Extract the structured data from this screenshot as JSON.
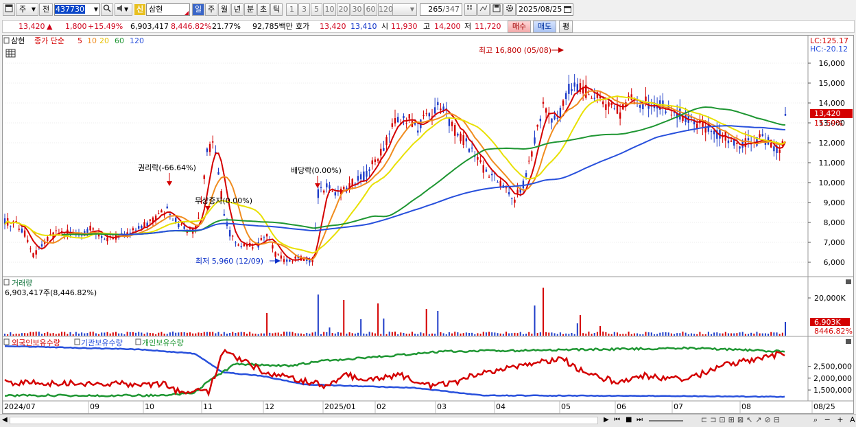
{
  "toolbar": {
    "type_label": "주",
    "scope_label": "전",
    "code": "437730",
    "credit_badge": "신",
    "stock_name": "삼현",
    "periods": [
      "일",
      "주",
      "월",
      "년",
      "분",
      "초",
      "틱"
    ],
    "active_period": "일",
    "intervals": [
      "1",
      "3",
      "5",
      "10",
      "20",
      "30",
      "60",
      "120"
    ],
    "page_current": "265",
    "page_total": "/347",
    "date": "2025/08/25"
  },
  "quote": {
    "price": "13,420",
    "arrow": "▲",
    "change": "1,800",
    "change_pct": "+15.49%",
    "volume": "6,903,417",
    "volume_ratio": "8,446.82%",
    "turnover": "21.77%",
    "amount": "92,785백만",
    "quote_label": "호가",
    "ask": "13,420",
    "bid": "13,410",
    "open_label": "시",
    "open": "11,930",
    "high_label": "고",
    "high": "14,200",
    "low_label": "저",
    "low": "11,720",
    "buy_label": "매수",
    "sell_label": "매도",
    "eval_label": "평"
  },
  "price_panel": {
    "stock_name": "삼현",
    "indicator_label": "종가 단순",
    "ma_periods": [
      "5",
      "10",
      "20",
      "60",
      "120"
    ],
    "ma_colors": [
      "#d40000",
      "#f08c1e",
      "#e8e000",
      "#1e9632",
      "#2850dc"
    ],
    "lc_label": "LC:125.17",
    "hc_label": "HC:-20.12",
    "price_ticks": [
      "6,000",
      "7,000",
      "8,000",
      "9,000",
      "10,000",
      "11,000",
      "12,000",
      "13,000",
      "14,000",
      "15,000",
      "16,000"
    ],
    "current_price_tag": "13,420",
    "current_pct_tag": "15.59%",
    "annotations": {
      "high": "최고 16,800 (05/08)",
      "low": "최저 5,960 (12/09)",
      "rights": "권리락(-66.64%)",
      "bonus": "무상증자(0.00%)",
      "dividend": "배당락(0.00%)"
    }
  },
  "volume_panel": {
    "title": "거래량",
    "summary": "6,903,417주(8,446.82%)",
    "tick": "20,000K",
    "current_tag": "6,903K",
    "pct_tag": "8446.82%"
  },
  "holdings_panel": {
    "legend": [
      "외국인보유수량",
      "기관보유수량",
      "개인보유수량"
    ],
    "colors": [
      "#d40000",
      "#2850dc",
      "#1e9632"
    ],
    "ticks": [
      "1,500,000",
      "2,000,000",
      "2,500,000"
    ]
  },
  "x_axis": {
    "labels": [
      "2024/07",
      "09",
      "10",
      "11",
      "12",
      "2025/01",
      "02",
      "03",
      "04",
      "05",
      "06",
      "07",
      "08",
      "08/25"
    ]
  }
}
